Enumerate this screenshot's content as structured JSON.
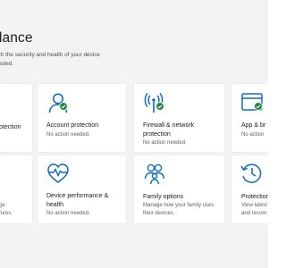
{
  "header": {
    "title": "lance",
    "description": "th the security and health of your device eded."
  },
  "cards": {
    "virus_protection": {
      "title": "otection",
      "status": ""
    },
    "account_protection": {
      "title": "Account protection",
      "status": "No action needed."
    },
    "firewall": {
      "title": "Firewall & network protection",
      "status": "No action needed."
    },
    "app_browser": {
      "title": "App & br",
      "status": "No action"
    },
    "device_security": {
      "title": "",
      "status": "ge fures."
    },
    "device_performance": {
      "title": "Device performance & health",
      "status": "No action needed."
    },
    "family_options": {
      "title": "Family options",
      "status": "Manage how your family uses their devices."
    },
    "protection_history": {
      "title": "Protection",
      "status": "View latest and recom"
    }
  },
  "colors": {
    "accent": "#0f6cbd",
    "success": "#1e8a3a",
    "card": "#ffffff",
    "background": "#f3f3f3"
  },
  "icons": {
    "account": "person-icon",
    "firewall": "wireless-signal-icon",
    "app_browser": "browser-window-icon",
    "performance": "heart-pulse-icon",
    "family": "people-group-icon",
    "history": "history-clock-icon",
    "status_ok": "checkmark-icon"
  }
}
